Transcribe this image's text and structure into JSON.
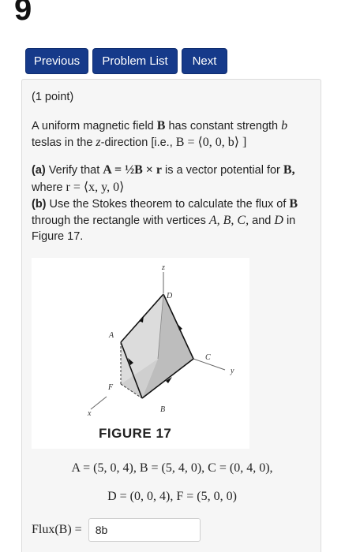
{
  "page": {
    "number": "9"
  },
  "nav": {
    "previous": "Previous",
    "problem_list": "Problem List",
    "next": "Next"
  },
  "problem": {
    "points": "(1 point)",
    "intro_a": "A uniform magnetic field",
    "intro_B": "B",
    "intro_b": "has constant strength",
    "intro_var_b": "b",
    "intro_c": "teslas in the",
    "intro_z": "z",
    "intro_d": "-direction [i.e.,",
    "intro_eq": "B = ⟨0, 0, b⟩ ]",
    "part_a_label": "(a)",
    "part_a_text": "Verify that",
    "part_a_math": "A = ½B × r",
    "part_a_tail": "is a vector potential for",
    "part_a_B": "B,",
    "part_a_where": "where",
    "part_a_r": "r = ⟨x, y, 0⟩",
    "part_b_label": "(b)",
    "part_b_line1": "Use the Stokes theorem to calculate the flux of",
    "part_b_B": "B",
    "part_b_line2": "through the rectangle with vertices",
    "part_b_verts": "A, B, C,",
    "part_b_and": "and",
    "part_b_D": "D",
    "part_b_in": "in",
    "part_b_line3": "Figure 17."
  },
  "figure": {
    "caption": "FIGURE 17",
    "labels": {
      "z": "z",
      "D": "D",
      "A": "A",
      "C": "C",
      "y": "y",
      "F": "F",
      "B": "B",
      "x": "x"
    }
  },
  "vertices": {
    "line1": "A = (5, 0, 4),    B = (5, 4, 0),    C = (0, 4, 0),",
    "line2": "D = (0, 0, 4),    F = (5, 0, 0)"
  },
  "answer": {
    "label": "Flux(B) =",
    "value": "8b"
  },
  "colors": {
    "nav_bg": "#163a8a",
    "panel_bg": "#f6f6f6"
  }
}
